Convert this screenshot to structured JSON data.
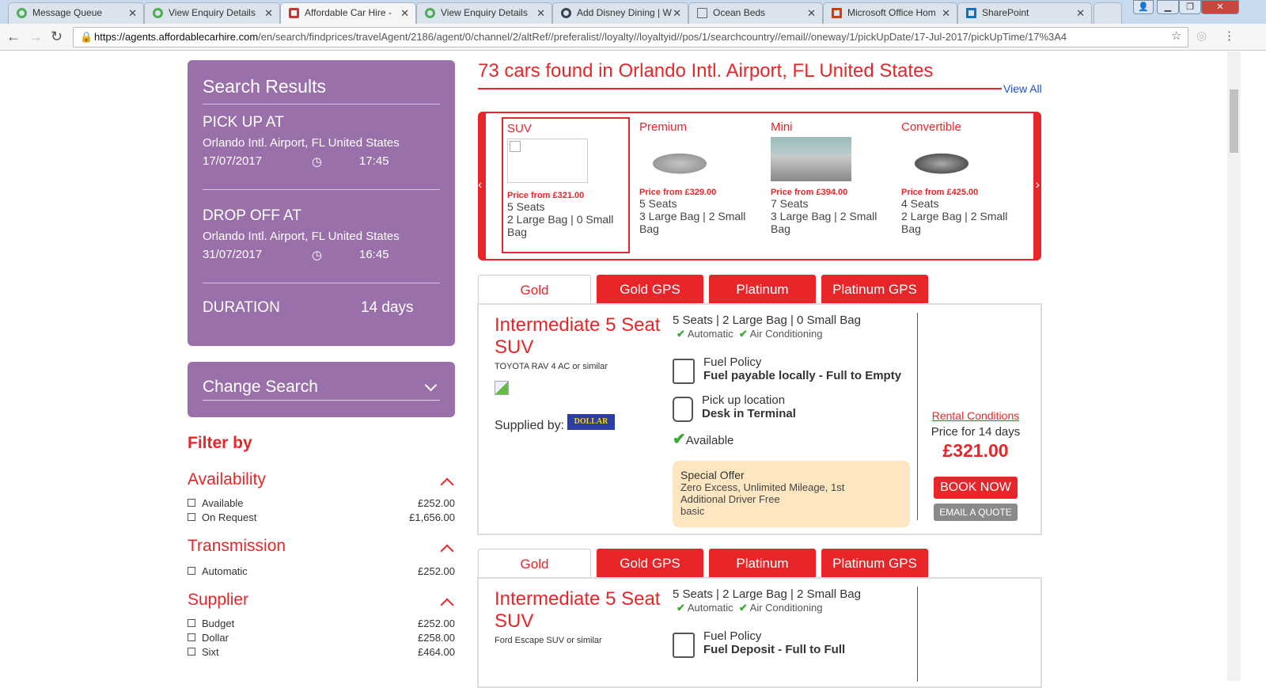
{
  "browser": {
    "tabs": [
      {
        "title": "Message Queue"
      },
      {
        "title": "View Enquiry Details"
      },
      {
        "title": "Affordable Car Hire - "
      },
      {
        "title": "View Enquiry Details"
      },
      {
        "title": "Add Disney Dining | W"
      },
      {
        "title": "Ocean Beds"
      },
      {
        "title": "Microsoft Office Hom"
      },
      {
        "title": "SharePoint"
      }
    ],
    "url_host": "https://agents.affordablecarhire.com",
    "url_path": "/en/search/findprices/travelAgent/2186/agent/0/channel/2/altRef//preferalist//loyalty//loyaltyid//pos/1/searchcountry//email//oneway/1/pickUpDate/17-Jul-2017/pickUpTime/17%3A4"
  },
  "sidebar": {
    "title": "Search Results",
    "pickup": {
      "label": "PICK UP AT",
      "location": "Orlando Intl. Airport, FL United States",
      "date": "17/07/2017",
      "time": "17:45"
    },
    "dropoff": {
      "label": "DROP OFF AT",
      "location": "Orlando Intl. Airport, FL United States",
      "date": "31/07/2017",
      "time": "16:45"
    },
    "duration_label": "DURATION",
    "duration": "14 days",
    "change_search": "Change Search",
    "filter_title": "Filter by",
    "groups": [
      {
        "title": "Availability",
        "items": [
          {
            "label": "Available",
            "price": "£252.00"
          },
          {
            "label": "On Request",
            "price": "£1,656.00"
          }
        ]
      },
      {
        "title": "Transmission",
        "items": [
          {
            "label": "Automatic",
            "price": "£252.00"
          }
        ]
      },
      {
        "title": "Supplier",
        "items": [
          {
            "label": "Budget",
            "price": "£252.00"
          },
          {
            "label": "Dollar",
            "price": "£258.00"
          },
          {
            "label": "Sixt",
            "price": "£464.00"
          }
        ]
      }
    ]
  },
  "main": {
    "heading": "73 cars found in Orlando Intl. Airport, FL United States",
    "view_all": "View All",
    "categories": [
      {
        "name": "SUV",
        "price": "Price from £321.00",
        "seats": "5 Seats",
        "bags": "2 Large Bag | 0 Small Bag"
      },
      {
        "name": "Premium",
        "price": "Price from £329.00",
        "seats": "5 Seats",
        "bags": "3 Large Bag | 2 Small Bag"
      },
      {
        "name": "Mini",
        "price": "Price from £394.00",
        "seats": "7 Seats",
        "bags": "3 Large Bag | 2 Small Bag"
      },
      {
        "name": "Convertible",
        "price": "Price from £425.00",
        "seats": "4 Seats",
        "bags": "2 Large Bag | 2 Small Bag"
      }
    ],
    "results": [
      {
        "tabs": [
          "Gold",
          "Gold GPS",
          "Platinum",
          "Platinum GPS"
        ],
        "name": "Intermediate 5 Seat SUV",
        "model": "TOYOTA RAV 4 AC or similar",
        "supplied_by": "Supplied by:",
        "supplier_logo": "DOLLAR",
        "specs": "5 Seats | 2 Large Bag | 0 Small Bag",
        "features": [
          "Automatic",
          "Air Conditioning"
        ],
        "fuel_label": "Fuel Policy",
        "fuel": "Fuel payable locally - Full to Empty",
        "pickup_label": "Pick up location",
        "pickup": "Desk in Terminal",
        "availability": "Available",
        "offer_title": "Special Offer",
        "offer_text": "Zero Excess, Unlimited Mileage, 1st Additional Driver Free",
        "offer_note": "basic",
        "rental_conditions": "Rental Conditions",
        "price_label": "Price for 14 days",
        "price": "£321.00",
        "book": "BOOK NOW",
        "email": "EMAIL A QUOTE"
      },
      {
        "tabs": [
          "Gold",
          "Gold GPS",
          "Platinum",
          "Platinum GPS"
        ],
        "name": "Intermediate 5 Seat SUV",
        "model": "Ford Escape SUV or similar",
        "specs": "5 Seats | 2 Large Bag | 2 Small Bag",
        "features": [
          "Automatic",
          "Air Conditioning"
        ],
        "fuel_label": "Fuel Policy",
        "fuel": "Fuel Deposit - Full to Full"
      }
    ]
  }
}
